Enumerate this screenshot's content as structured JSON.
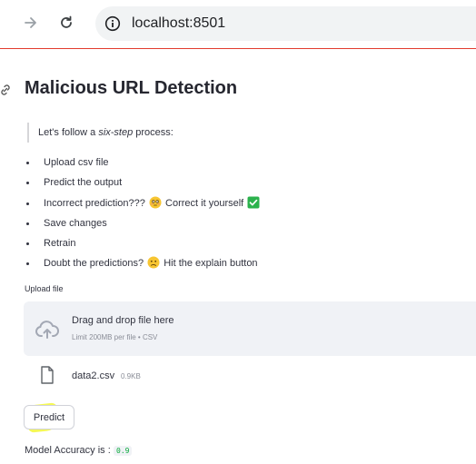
{
  "browser": {
    "url": "localhost:8501"
  },
  "page": {
    "title": "Malicious URL Detection",
    "intro_prefix": "Let's follow a ",
    "intro_emphasis": "six-step",
    "intro_suffix": " process:",
    "steps": [
      {
        "text": "Upload csv file"
      },
      {
        "text": "Predict the output"
      },
      {
        "text": "Incorrect prediction???",
        "emoji": "flushed-face-icon",
        "after": "Correct it yourself",
        "emoji2": "check-mark-icon"
      },
      {
        "text": "Save changes"
      },
      {
        "text": "Retrain"
      },
      {
        "text": "Doubt the predictions?",
        "emoji": "confused-face-icon",
        "after": "Hit the explain button"
      }
    ],
    "upload": {
      "label": "Upload file",
      "drop_title": "Drag and drop file here",
      "drop_subtitle": "Limit 200MB per file • CSV",
      "file_name": "data2.csv",
      "file_size": "0.9KB"
    },
    "predict_label": "Predict",
    "accuracy_label": "Model Accuracy is :",
    "accuracy_value": "0.9"
  },
  "colors": {
    "browser_divider": "#e23b2e",
    "dropzone_bg": "#f0f2f6",
    "accuracy_value": "#09ab3b",
    "highlight": "#f2f51e"
  }
}
